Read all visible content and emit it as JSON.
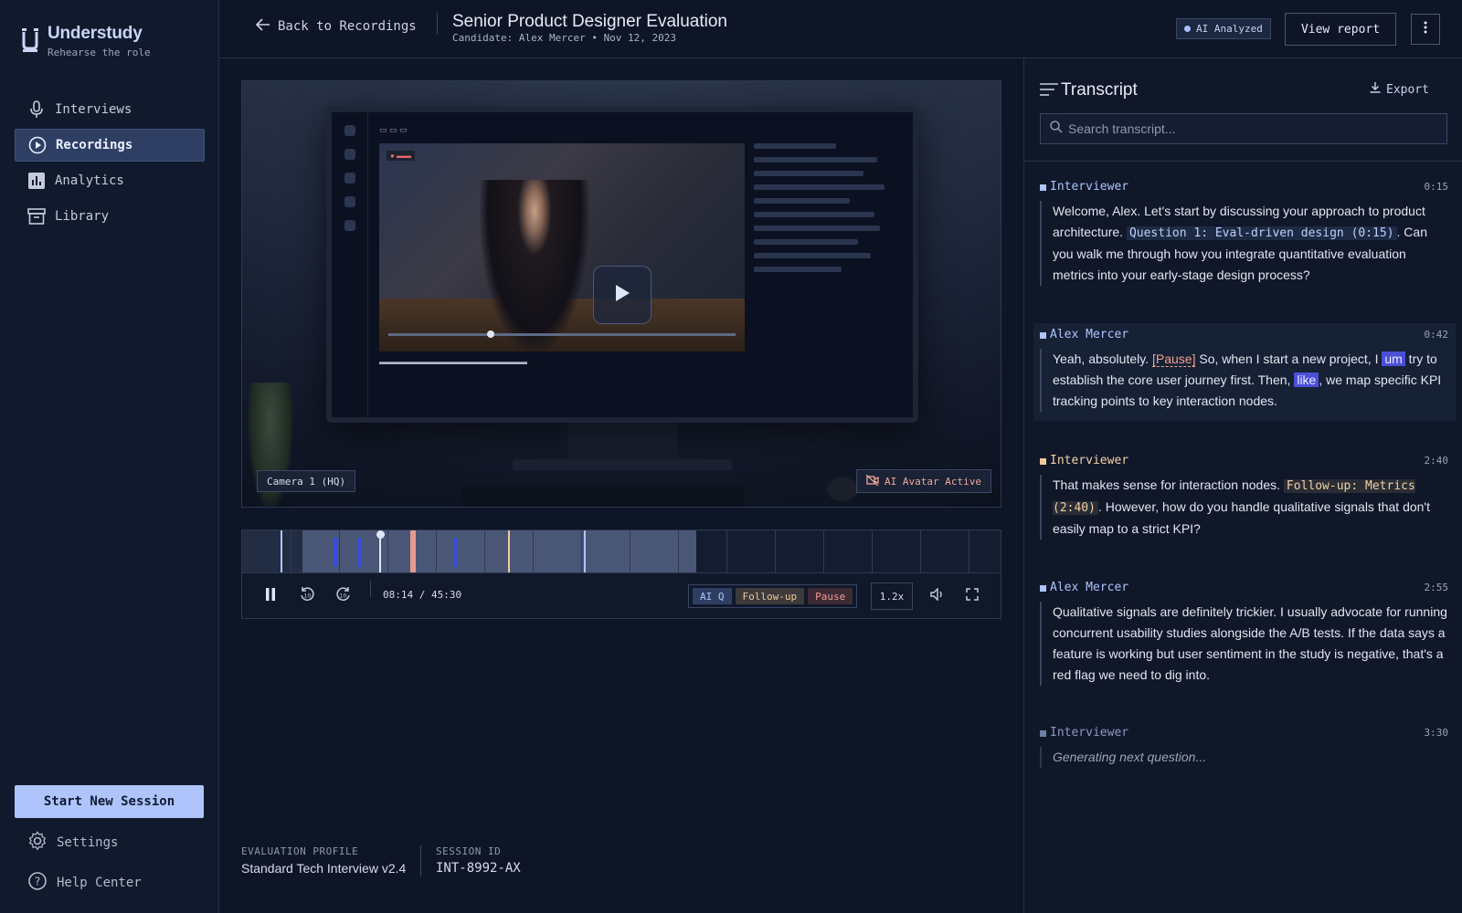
{
  "app": {
    "name": "Understudy",
    "tagline": "Rehearse the role",
    "accent": "#aec4fb"
  },
  "sidebar": {
    "items": [
      {
        "label": "Interviews",
        "icon": "microphone-icon"
      },
      {
        "label": "Recordings",
        "icon": "play-circle-icon",
        "active": true
      },
      {
        "label": "Analytics",
        "icon": "bar-chart-icon"
      },
      {
        "label": "Library",
        "icon": "archive-icon"
      }
    ],
    "start_session": "Start New Session",
    "settings": "Settings",
    "help": "Help Center"
  },
  "header": {
    "back": "Back to Recordings",
    "title": "Senior Product Designer Evaluation",
    "subtitle": "Candidate: Alex Mercer • Nov 12, 2023",
    "ai_badge": "AI Analyzed",
    "view_report": "View report"
  },
  "video": {
    "camera_label": "Camera 1 (HQ)",
    "avatar_badge": "AI Avatar Active"
  },
  "player": {
    "time": "08:14 / 45:30",
    "progress_fraction": 0.181,
    "tags": {
      "ai_q": "AI Q",
      "follow_up": "Follow-up",
      "pause": "Pause"
    },
    "speed": "1.2x"
  },
  "info": {
    "profile_label": "EVALUATION PROFILE",
    "profile_value": "Standard Tech Interview v2.4",
    "session_label": "SESSION ID",
    "session_value": "INT-8992-AX"
  },
  "transcript": {
    "title": "Transcript",
    "export": "Export",
    "search_placeholder": "Search transcript...",
    "messages": [
      {
        "speaker": "Interviewer",
        "time": "0:15",
        "p1": "Welcome, Alex. Let's start by discussing your approach to product architecture. ",
        "chip": "Question 1: Eval-driven design (0:15)",
        "p2": ". Can you walk me through how you integrate quantitative evaluation metrics into your early-stage design process?"
      },
      {
        "speaker": "Alex Mercer",
        "time": "0:42",
        "p1": "Yeah, absolutely. ",
        "pause": "[Pause]",
        "p2": " So, when I start a new project, I ",
        "filler1": "um",
        "p3": " try to establish the core user journey first. Then, ",
        "filler2": "like",
        "p4": ", we map specific KPI tracking points to key interaction nodes."
      },
      {
        "speaker": "Interviewer",
        "time": "2:40",
        "p1": "That makes sense for interaction nodes. ",
        "chip": "Follow-up: Metrics (2:40)",
        "p2": ". However, how do you handle qualitative signals that don't easily map to a strict KPI?"
      },
      {
        "speaker": "Alex Mercer",
        "time": "2:55",
        "p1": "Qualitative signals are definitely trickier. I usually advocate for running concurrent usability studies alongside the A/B tests. If the data says a feature is working but user sentiment in the study is negative, that's a red flag we need to dig into."
      },
      {
        "speaker": "Interviewer",
        "time": "3:30",
        "p1": "Generating next question..."
      }
    ]
  }
}
